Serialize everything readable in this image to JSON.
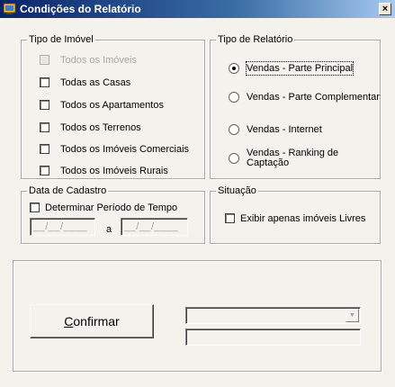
{
  "window": {
    "title": "Condições do Relatório",
    "close_label": "×"
  },
  "tipo_imovel": {
    "legend": "Tipo de Imóvel",
    "items": [
      {
        "label": "Todos os Imóveis",
        "checked": false,
        "enabled": false
      },
      {
        "label": "Todas as Casas",
        "checked": false,
        "enabled": true
      },
      {
        "label": "Todos os Apartamentos",
        "checked": false,
        "enabled": true
      },
      {
        "label": "Todos os Terrenos",
        "checked": false,
        "enabled": true
      },
      {
        "label": "Todos os Imóveis Comerciais",
        "checked": false,
        "enabled": true
      },
      {
        "label": "Todos os Imóveis Rurais",
        "checked": false,
        "enabled": true
      }
    ]
  },
  "tipo_relatorio": {
    "legend": "Tipo de Relatório",
    "options": [
      {
        "label": "Vendas - Parte Principal",
        "selected": true
      },
      {
        "label": "Vendas - Parte Complementar",
        "selected": false
      },
      {
        "label": "Vendas - Internet",
        "selected": false
      },
      {
        "label_line1": "Vendas - Ranking de",
        "label_line2": "Captação",
        "selected": false
      }
    ]
  },
  "data_cadastro": {
    "legend": "Data de Cadastro",
    "checkbox_label": "Determinar Período de Tempo",
    "date_from": "__/__/____",
    "separator": "a",
    "date_to": "__/__/____"
  },
  "situacao": {
    "legend": "Situação",
    "checkbox_label": "Exibir apenas imóveis Livres"
  },
  "footer": {
    "confirm_label_underlined": "C",
    "confirm_label_rest": "onfirmar",
    "combo_value": "",
    "text_value": ""
  }
}
